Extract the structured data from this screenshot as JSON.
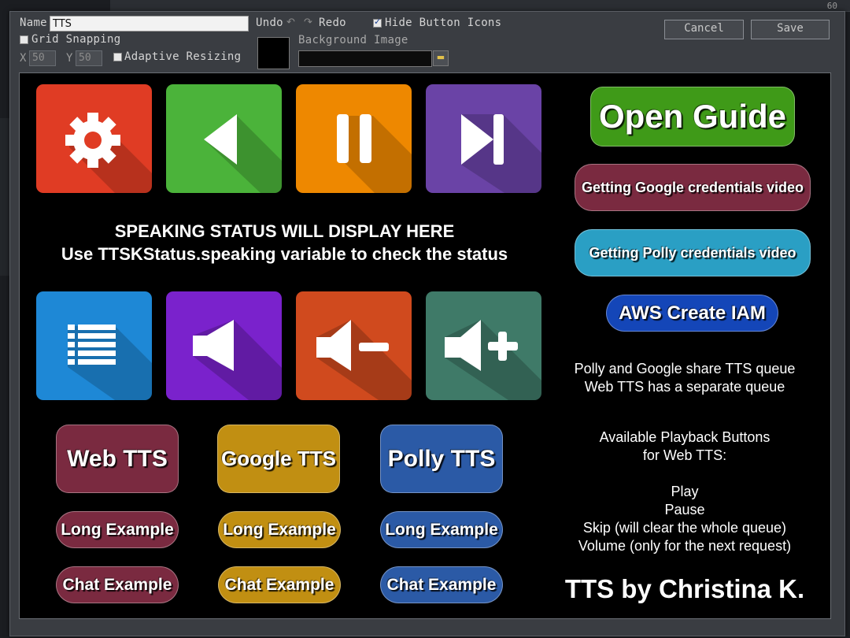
{
  "background": {
    "corner_number": "60"
  },
  "toolbar": {
    "name_label": "Name",
    "name_value": "TTS",
    "undo_label": "Undo",
    "redo_label": "Redo",
    "hide_icons_label": "Hide Button Icons",
    "hide_icons_checked": true,
    "grid_snapping_label": "Grid Snapping",
    "grid_snapping_checked": false,
    "x_label": "X",
    "x_value": "50",
    "y_label": "Y",
    "y_value": "50",
    "adaptive_label": "Adaptive Resizing",
    "adaptive_checked": false,
    "bg_color": "#000000",
    "bg_image_label": "Background Image",
    "bg_image_value": "",
    "cancel_label": "Cancel",
    "save_label": "Save"
  },
  "canvas": {
    "tiles_top": [
      {
        "name": "gear-icon",
        "color": "#e03c24"
      },
      {
        "name": "previous-icon",
        "color": "#4bb33a"
      },
      {
        "name": "pause-icon",
        "color": "#ee8800"
      },
      {
        "name": "skip-icon",
        "color": "#6a43a6"
      }
    ],
    "tiles_bottom": [
      {
        "name": "list-icon",
        "color": "#1e88d6"
      },
      {
        "name": "volume-icon",
        "color": "#7a22cc"
      },
      {
        "name": "volume-down-icon",
        "color": "#d04a1e"
      },
      {
        "name": "volume-up-icon",
        "color": "#3f7a68"
      }
    ],
    "status_line1": "SPEAKING STATUS WILL DISPLAY HERE",
    "status_line2": "Use TTSKStatus.speaking variable to check the status",
    "tts_buttons": [
      {
        "label": "Web TTS",
        "color": "#7a2a40"
      },
      {
        "label": "Google TTS",
        "color": "#c18f12"
      },
      {
        "label": "Polly TTS",
        "color": "#2b5aa6"
      }
    ],
    "long_label": "Long Example",
    "chat_label": "Chat Example",
    "open_guide": "Open Guide",
    "google_video": "Getting Google credentials video",
    "polly_video": "Getting Polly credentials video",
    "aws_iam": "AWS Create IAM",
    "queue_line1": "Polly and Google share TTS queue",
    "queue_line2": "Web TTS has a separate queue",
    "available_line1": "Available Playback Buttons",
    "available_line2": "for Web TTS:",
    "play": "Play",
    "pause": "Pause",
    "skip": "Skip (will clear the whole queue)",
    "volume": "Volume (only for the next request)",
    "credit": "TTS by Christina K.",
    "colors": {
      "open_guide": "#3f9a18",
      "google_video": "#7a2a40",
      "polly_video": "#2a9fc4",
      "aws_iam": "#1446b8"
    }
  }
}
